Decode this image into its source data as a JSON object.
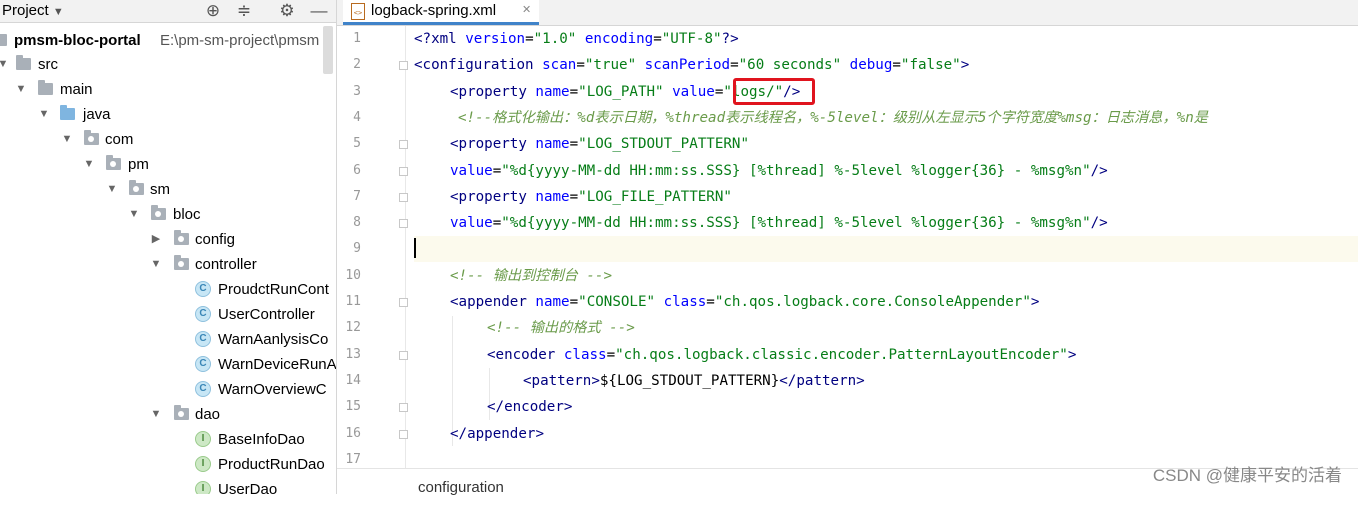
{
  "project_panel": {
    "title": "Project",
    "tree": [
      {
        "label": "pmsm-bloc-portal",
        "path": "E:\\pm-sm-project\\pmsm",
        "kind": "module"
      },
      {
        "label": "src",
        "kind": "folder"
      },
      {
        "label": "main",
        "kind": "folder"
      },
      {
        "label": "java",
        "kind": "source-folder"
      },
      {
        "label": "com",
        "kind": "package"
      },
      {
        "label": "pm",
        "kind": "package"
      },
      {
        "label": "sm",
        "kind": "package"
      },
      {
        "label": "bloc",
        "kind": "package"
      },
      {
        "label": "config",
        "kind": "package"
      },
      {
        "label": "controller",
        "kind": "package"
      },
      {
        "label": "ProudctRunCont",
        "kind": "class"
      },
      {
        "label": "UserController",
        "kind": "class"
      },
      {
        "label": "WarnAanlysisCo",
        "kind": "class"
      },
      {
        "label": "WarnDeviceRunA",
        "kind": "class"
      },
      {
        "label": "WarnOverviewC",
        "kind": "class"
      },
      {
        "label": "dao",
        "kind": "package"
      },
      {
        "label": "BaseInfoDao",
        "kind": "interface"
      },
      {
        "label": "ProductRunDao",
        "kind": "interface"
      },
      {
        "label": "UserDao",
        "kind": "interface"
      }
    ],
    "class_icon_letter": "C",
    "interface_icon_letter": "I"
  },
  "editor": {
    "tab_label": "logback-spring.xml",
    "tab_close": "✕",
    "line_numbers": [
      "1",
      "2",
      "3",
      "4",
      "5",
      "6",
      "7",
      "8",
      "9",
      "10",
      "11",
      "12",
      "13",
      "14",
      "15",
      "16",
      "17"
    ],
    "lines": {
      "l1": {
        "a": "<?",
        "b": "xml ",
        "c": "version",
        "d": "=",
        "e": "\"1.0\"",
        "f": " encoding",
        "g": "=",
        "h": "\"UTF-8\"",
        "i": "?>"
      },
      "l2": {
        "a": "<",
        "b": "configuration",
        "c": " scan",
        "d": "=",
        "e": "\"true\"",
        "f": " scanPeriod",
        "g": "=",
        "h": "\"60 seconds\"",
        "i": " debug",
        "j": "=",
        "k": "\"false\"",
        "l": ">"
      },
      "l3": {
        "a": "<",
        "b": "property",
        "c": " name",
        "d": "=",
        "e": "\"LOG_PATH\"",
        "f": " value",
        "g": "=",
        "h": "\"logs/\"",
        "i": "/>"
      },
      "l4": {
        "a": "<!--格式化输出：%d表示日期，%thread表示线程名，%-5level：级别从左显示5个字符宽度%msg：日志消息，%n是"
      },
      "l5": {
        "a": "<",
        "b": "property",
        "c": " name",
        "d": "=",
        "e": "\"LOG_STDOUT_PATTERN\""
      },
      "l6": {
        "a": "value",
        "b": "=",
        "c": "\"%d{yyyy-MM-dd HH:mm:ss.SSS} [%thread] %-5level %logger{36} - %msg%n\"",
        "d": "/>"
      },
      "l7": {
        "a": "<",
        "b": "property",
        "c": " name",
        "d": "=",
        "e": "\"LOG_FILE_PATTERN\""
      },
      "l8": {
        "a": "value",
        "b": "=",
        "c": "\"%d{yyyy-MM-dd HH:mm:ss.SSS} [%thread] %-5level %logger{36} - %msg%n\"",
        "d": "/>"
      },
      "l10": {
        "a": "<!-- 输出到控制台 -->"
      },
      "l11": {
        "a": "<",
        "b": "appender",
        "c": " name",
        "d": "=",
        "e": "\"CONSOLE\"",
        "f": " class",
        "g": "=",
        "h": "\"ch.qos.logback.core.ConsoleAppender\"",
        "i": ">"
      },
      "l12": {
        "a": "<!-- 输出的格式 -->"
      },
      "l13": {
        "a": "<",
        "b": "encoder",
        "c": " class",
        "d": "=",
        "e": "\"ch.qos.logback.classic.encoder.PatternLayoutEncoder\"",
        "f": ">"
      },
      "l14": {
        "a": "<",
        "b": "pattern",
        "c": ">",
        "d": "${LOG_STDOUT_PATTERN}",
        "e": "</",
        "f": "pattern",
        "g": ">"
      },
      "l15": {
        "a": "</",
        "b": "encoder",
        "c": ">"
      },
      "l16": {
        "a": "</",
        "b": "appender",
        "c": ">"
      }
    }
  },
  "status": {
    "breadcrumb": "configuration"
  },
  "watermark": "CSDN @健康平安的活着",
  "colors": {
    "accent": "#4083c9",
    "highlight_box": "#e0141e",
    "xml_tag": "#000080",
    "xml_attr": "#0000ff",
    "xml_value": "#067d17",
    "comment": "#8c8c8c"
  }
}
